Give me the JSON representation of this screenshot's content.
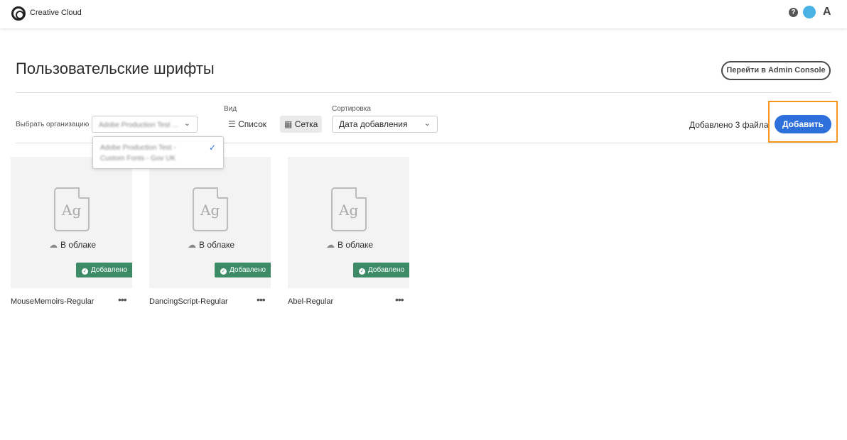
{
  "header": {
    "brand": "Creative Cloud",
    "help_icon": "?",
    "adobe_logo": "A"
  },
  "page": {
    "title": "Пользовательские шрифты",
    "admin_button": "Перейти в Admin Console"
  },
  "toolbar": {
    "org_label": "Выбрать организацию",
    "org_value": "Adobe Production Test ...",
    "org_menu_item": "Adobe Production Test - Custom Fonts - Gov UK",
    "view_label": "Вид",
    "view_list": "Список",
    "view_grid": "Сетка",
    "view_selected": "Сетка",
    "sort_label": "Сортировка",
    "sort_value": "Дата добавления",
    "added_count": "Добавлено 3 файла",
    "add_button": "Добавить"
  },
  "colors": {
    "accent": "#2d6fdb",
    "badge": "#3d8a67",
    "highlight": "#f5961e"
  },
  "fonts": [
    {
      "name": "MouseMemoirs-Regular",
      "status": "В облаке",
      "badge": "Добавлено",
      "preview": "Ag"
    },
    {
      "name": "DancingScript-Regular",
      "status": "В облаке",
      "badge": "Добавлено",
      "preview": "Ag"
    },
    {
      "name": "Abel-Regular",
      "status": "В облаке",
      "badge": "Добавлено",
      "preview": "Ag"
    }
  ]
}
